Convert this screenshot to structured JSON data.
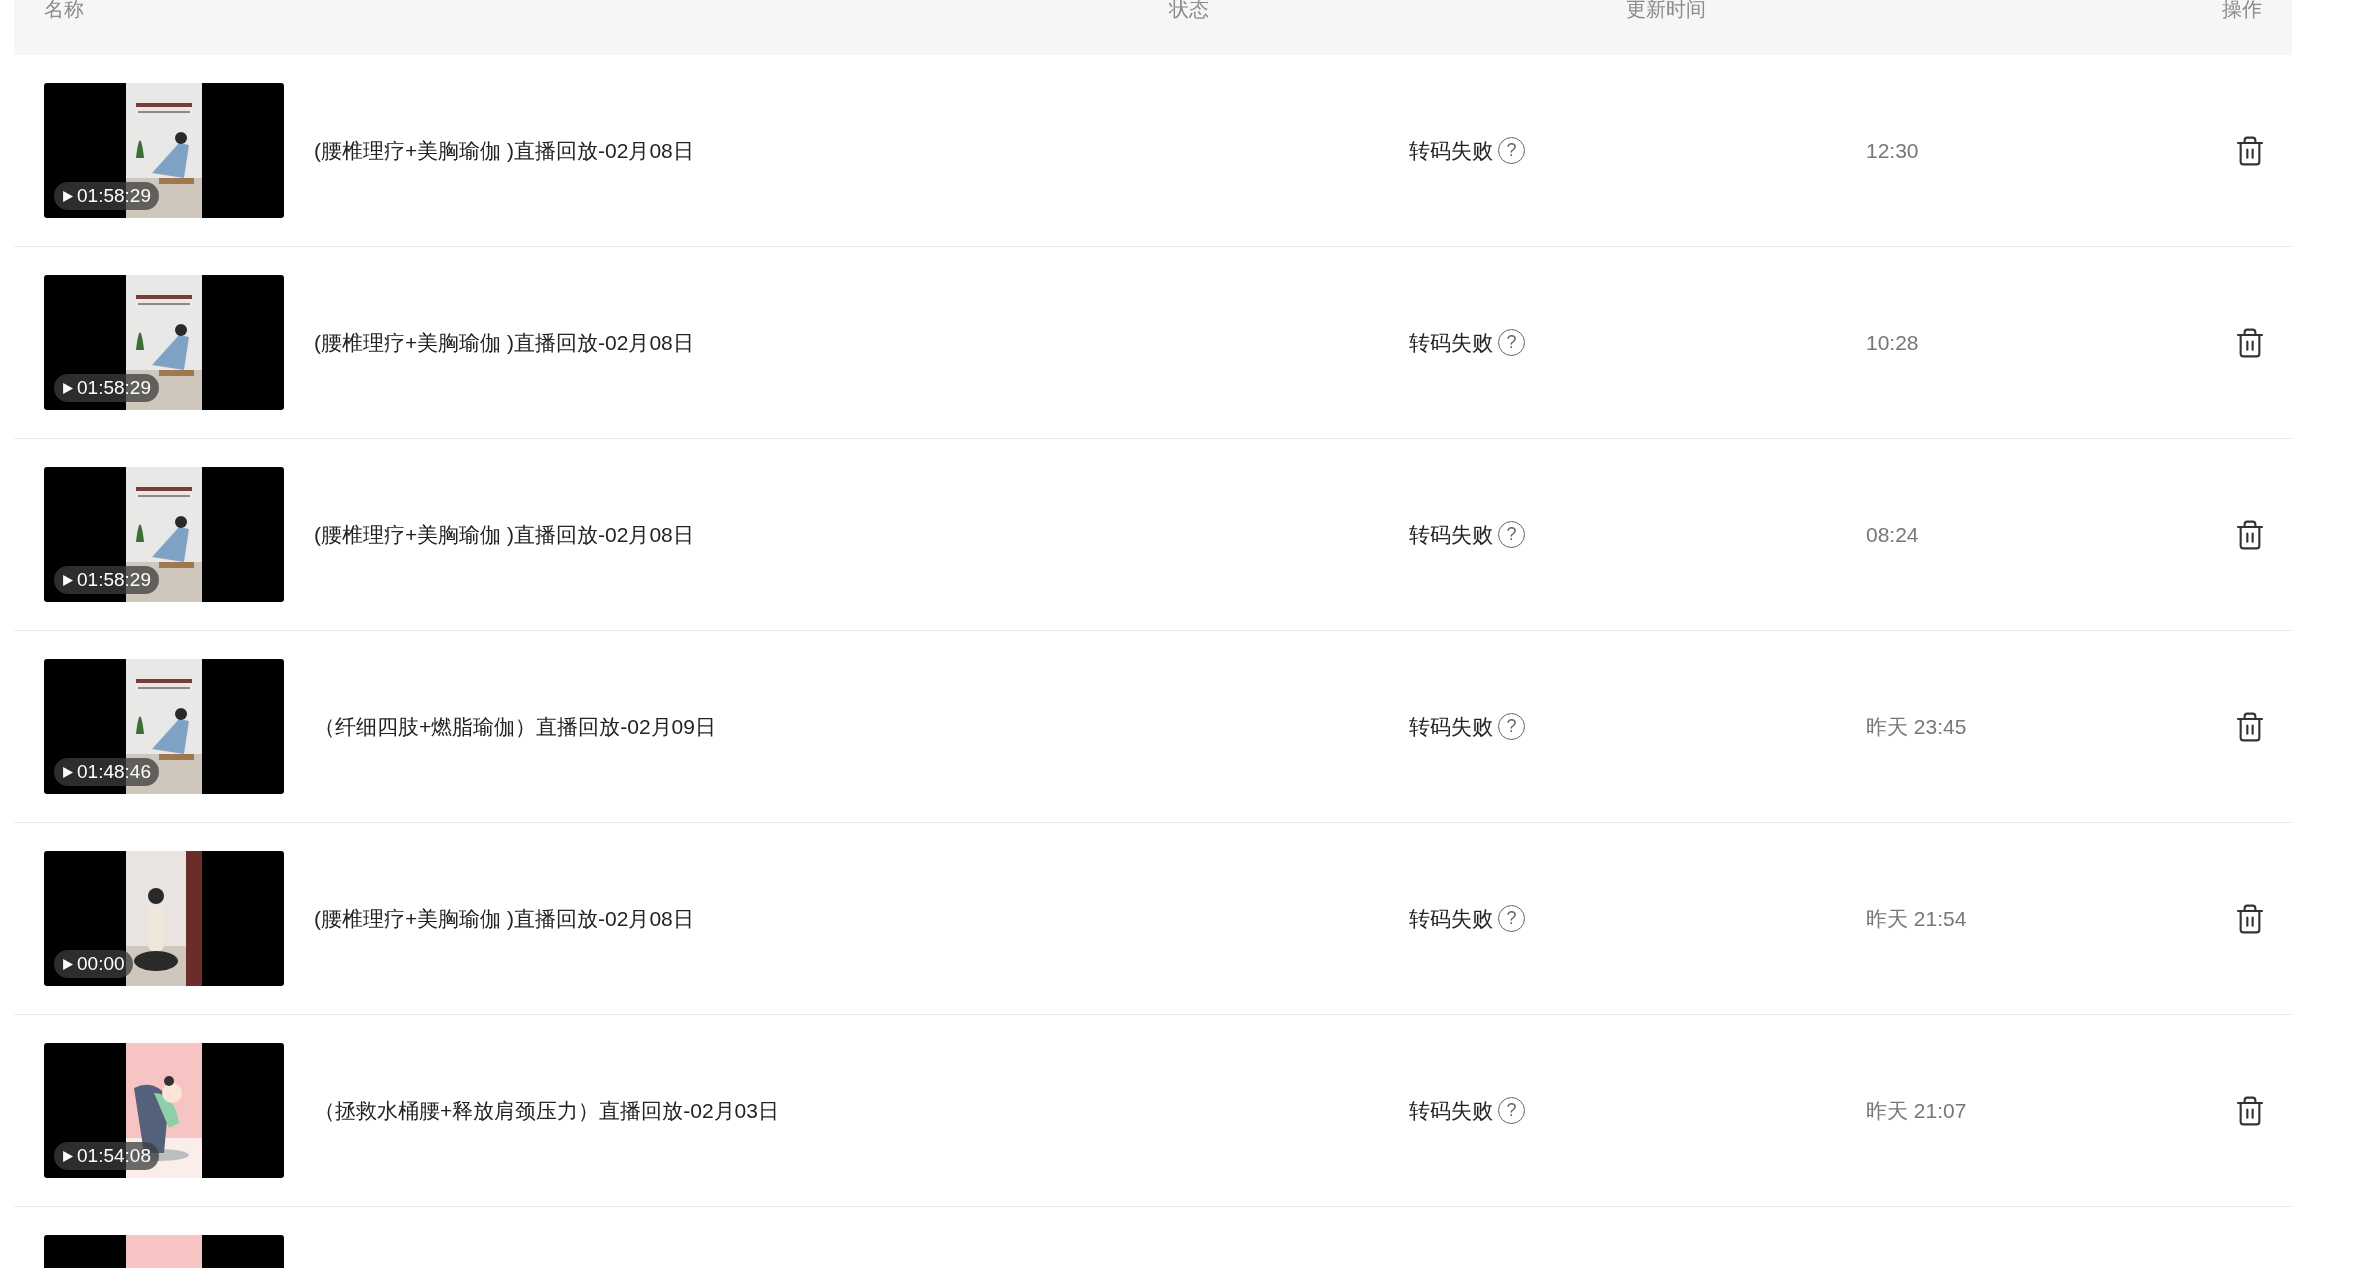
{
  "table": {
    "columns": [
      "名称",
      "状态",
      "更新时间",
      "操作"
    ],
    "rows": [
      {
        "thumbnail": {
          "kind": "picture",
          "duration": "01:58:29"
        },
        "title": "(腰椎理疗+美胸瑜伽 )直播回放-02月08日",
        "status": "转码失败",
        "help": "?",
        "time": "12:30"
      },
      {
        "thumbnail": {
          "kind": "picture",
          "duration": "01:58:29"
        },
        "title": "(腰椎理疗+美胸瑜伽 )直播回放-02月08日",
        "status": "转码失败",
        "help": "?",
        "time": "10:28"
      },
      {
        "thumbnail": {
          "kind": "picture",
          "duration": "01:58:29"
        },
        "title": "(腰椎理疗+美胸瑜伽 )直播回放-02月08日",
        "status": "转码失败",
        "help": "?",
        "time": "08:24"
      },
      {
        "thumbnail": {
          "kind": "picture",
          "duration": "01:48:46"
        },
        "title": "（纤细四肢+燃脂瑜伽）直播回放-02月09日",
        "status": "转码失败",
        "help": "?",
        "time": "昨天 23:45"
      },
      {
        "thumbnail": {
          "kind": "picture",
          "duration": "00:00"
        },
        "title": "(腰椎理疗+美胸瑜伽 )直播回放-02月08日",
        "status": "转码失败",
        "help": "?",
        "time": "昨天 21:54"
      },
      {
        "thumbnail": {
          "kind": "picture",
          "duration": "01:54:08"
        },
        "title": "（拯救水桶腰+释放肩颈压力）直播回放-02月03日",
        "status": "转码失败",
        "help": "?",
        "time": "昨天 21:07"
      },
      {
        "thumbnail": {
          "kind": "picture"
        }
      }
    ]
  }
}
